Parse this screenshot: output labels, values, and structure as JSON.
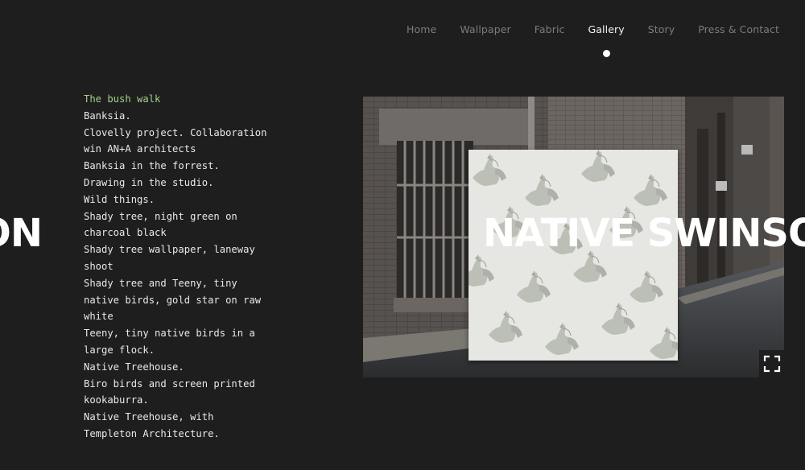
{
  "nav": {
    "items": [
      {
        "label": "Home",
        "active": false
      },
      {
        "label": "Wallpaper",
        "active": false
      },
      {
        "label": "Fabric",
        "active": false
      },
      {
        "label": "Gallery",
        "active": true
      },
      {
        "label": "Story",
        "active": false
      },
      {
        "label": "Press & Contact",
        "active": false
      }
    ]
  },
  "captions": [
    {
      "text": "The bush walk",
      "active": true
    },
    {
      "text": "Banksia.",
      "active": false
    },
    {
      "text": "Clovelly project. Collaboration win AN+A architects",
      "active": false
    },
    {
      "text": "Banksia in the forrest.",
      "active": false
    },
    {
      "text": "Drawing in the studio.",
      "active": false
    },
    {
      "text": "Wild things.",
      "active": false
    },
    {
      "text": "Shady tree, night green on charcoal black",
      "active": false
    },
    {
      "text": "Shady tree wallpaper, laneway shoot",
      "active": false
    },
    {
      "text": "Shady tree and Teeny, tiny native birds, gold star on raw white",
      "active": false
    },
    {
      "text": "Teeny, tiny native birds in a large flock.",
      "active": false
    },
    {
      "text": "Native Treehouse.",
      "active": false
    },
    {
      "text": "Biro birds and screen printed kookaburra.",
      "active": false
    },
    {
      "text": "Native Treehouse, with Templeton Architecture.",
      "active": false
    }
  ],
  "headline": {
    "previous": "ON",
    "current": "NATIVE SWINSO"
  },
  "gallery": {
    "fullscreen_icon": "fullscreen-icon"
  },
  "colors": {
    "background": "#1e1e1e",
    "nav_inactive": "#7c7c7c",
    "nav_active": "#f2f2f2",
    "caption_active": "#a6cf8e",
    "caption_text": "#e9e9e9"
  }
}
